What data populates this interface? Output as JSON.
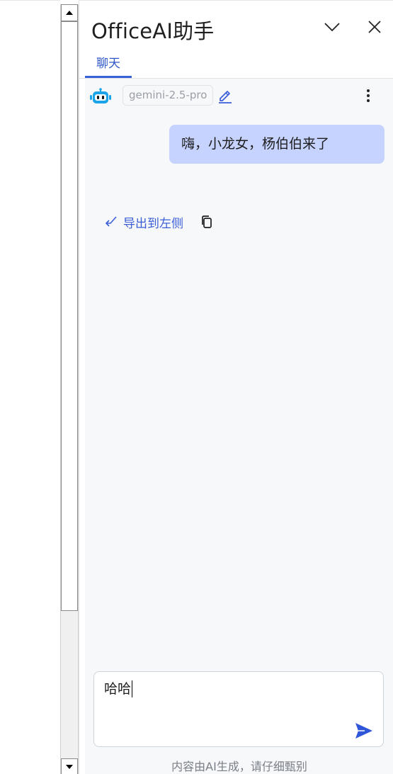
{
  "panel": {
    "title": "OfficeAI助手"
  },
  "tabs": [
    {
      "label": "聊天",
      "active": true
    }
  ],
  "chat": {
    "model_name": "gemini-2.5-pro",
    "messages": [
      {
        "role": "user",
        "text": "嗨，小龙女，杨伯伯来了"
      }
    ],
    "export_label": "导出到左侧"
  },
  "input": {
    "value": "哈哈"
  },
  "footer": {
    "note": "内容由AI生成，请仔细甄别"
  },
  "colors": {
    "accent": "#3b5ed8",
    "user_bubble": "#c6d3ff",
    "bot_icon": "#1aa3e8",
    "chat_bg": "#f7f8fa"
  },
  "icons": {
    "bot": "robot-icon",
    "edit": "pencil-icon",
    "more": "more-vertical-icon",
    "export": "reply-arrow-icon",
    "copy": "copy-icon",
    "send": "send-icon",
    "collapse": "chevron-down-icon",
    "close": "close-icon"
  }
}
